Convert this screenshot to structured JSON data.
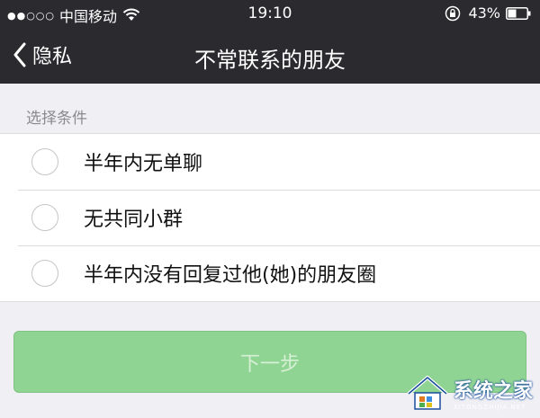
{
  "status_bar": {
    "signal_dots": "●●○○○",
    "carrier": "中国移动",
    "time": "19:10",
    "battery_percent": "43%"
  },
  "nav": {
    "back_label": "隐私",
    "title": "不常联系的朋友"
  },
  "section": {
    "header": "选择条件"
  },
  "options": [
    {
      "label": "半年内无单聊",
      "selected": false
    },
    {
      "label": "无共同小群",
      "selected": false
    },
    {
      "label": "半年内没有回复过他(她)的朋友圈",
      "selected": false
    }
  ],
  "actions": {
    "next_label": "下一步",
    "next_enabled": false
  },
  "watermark": {
    "name": "系统之家",
    "subtitle": "XITONGZHIJIA.NET"
  },
  "colors": {
    "nav_background": "#2b2b2f",
    "page_background": "#efeff4",
    "button_green": "#90d493"
  }
}
